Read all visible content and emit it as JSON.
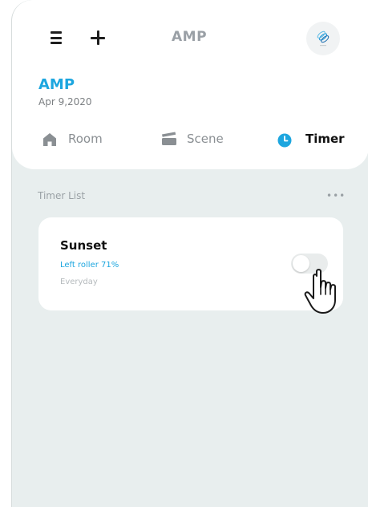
{
  "header": {
    "title": "AMP",
    "menu_icon": "hamburger-menu-icon",
    "add_icon": "plus-icon",
    "avatar_icon": "device-avatar-icon"
  },
  "home": {
    "name": "AMP",
    "date": "Apr 9,2020"
  },
  "tabs": [
    {
      "label": "Room",
      "icon": "house-icon",
      "active": false
    },
    {
      "label": "Scene",
      "icon": "scene-clapper-icon",
      "active": false
    },
    {
      "label": "Timer",
      "icon": "clock-icon",
      "active": true
    }
  ],
  "timer_list": {
    "title": "Timer List",
    "more_icon": "more-dots-icon",
    "items": [
      {
        "name": "Sunset",
        "action": "Left roller 71%",
        "repeat": "Everyday",
        "enabled": false
      }
    ]
  },
  "colors": {
    "accent": "#1da6df",
    "background": "#e8eeee",
    "card": "#ffffff",
    "muted_text": "#8a8f93"
  },
  "cursor": "hand-pointer-icon"
}
